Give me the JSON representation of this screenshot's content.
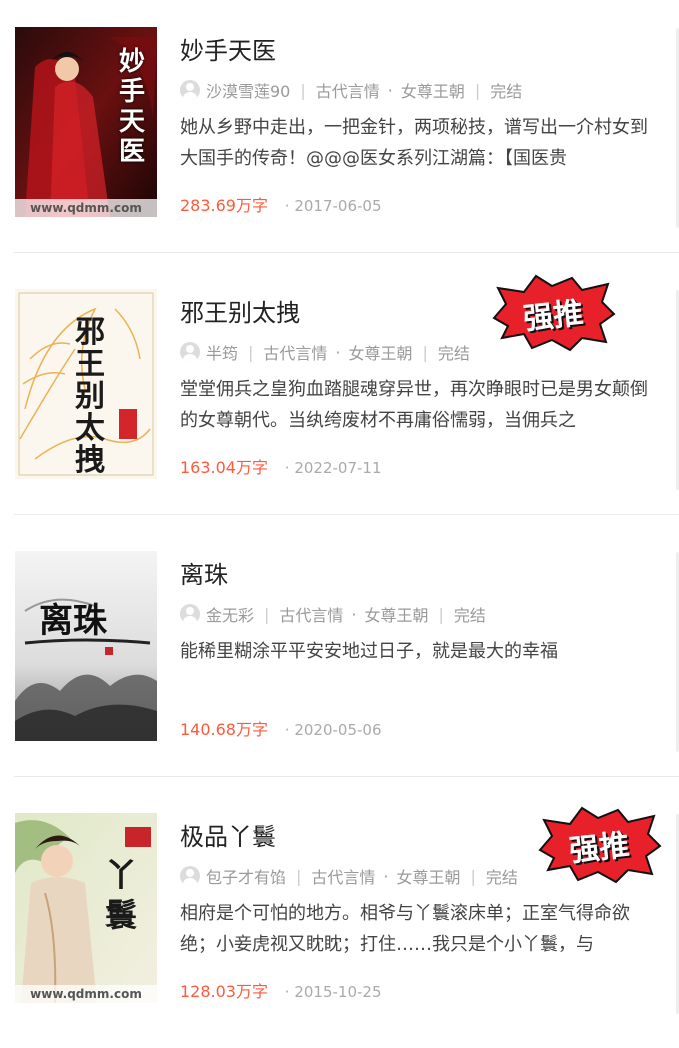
{
  "books": [
    {
      "title": "妙手天医",
      "author": "沙漠雪莲90",
      "category": "古代言情",
      "subcategory": "女尊王朝",
      "status": "完结",
      "description": "她从乡野中走出，一把金针，两项秘技，谱写出一介村女到大国手的传奇！@@@医女系列江湖篇：【国医贵",
      "words": "283.69万字",
      "date": "2017-06-05",
      "cover": {
        "title_chars": "妙手天医",
        "watermark": "www.qdmm.com"
      }
    },
    {
      "title": "邪王别太拽",
      "author": "半筠",
      "category": "古代言情",
      "subcategory": "女尊王朝",
      "status": "完结",
      "description": "堂堂佣兵之皇狗血踏腿魂穿异世，再次睁眼时已是男女颠倒的女尊朝代。当纨绔废材不再庸俗懦弱，当佣兵之",
      "words": "163.04万字",
      "date": "2022-07-11",
      "badge": "强推",
      "cover": {
        "title_chars": "邪王别太拽"
      }
    },
    {
      "title": "离珠",
      "author": "金无彩",
      "category": "古代言情",
      "subcategory": "女尊王朝",
      "status": "完结",
      "description": "能稀里糊涂平平安安地过日子，就是最大的幸福",
      "words": "140.68万字",
      "date": "2020-05-06",
      "cover": {
        "title_chars": "离珠"
      }
    },
    {
      "title": "极品丫鬟",
      "author": "包子才有馅",
      "category": "古代言情",
      "subcategory": "女尊王朝",
      "status": "完结",
      "description": "相府是个可怕的地方。相爷与丫鬟滚床单；正室气得命欲绝；小妾虎视又眈眈；打住……我只是个小丫鬟，与",
      "words": "128.03万字",
      "date": "2015-10-25",
      "badge": "强推",
      "cover": {
        "title_chars": "丫鬟",
        "watermark": "www.qdmm.com"
      }
    }
  ],
  "colors": {
    "accent": "#ff5a3c",
    "badge_red": "#e8202a",
    "divider": "#e9e9e9"
  }
}
